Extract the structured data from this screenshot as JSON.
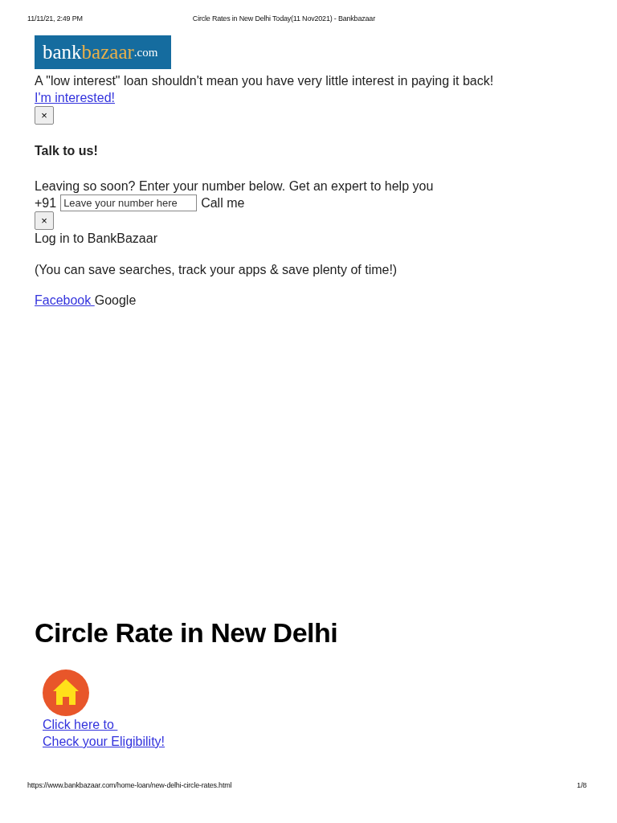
{
  "print_header": {
    "date": "11/11/21, 2:49 PM",
    "title": "Circle Rates in New Delhi Today(11 Nov2021) - Bankbazaar"
  },
  "logo": [
    {
      "text": "bank",
      "color": "#ffffff"
    },
    {
      "text": "bazaar",
      "color": "#e8b04a"
    },
    {
      "text": ".com",
      "color": "#ffffff"
    }
  ],
  "promo": {
    "text": "A \"low interest\" loan shouldn't mean you have very little interest in paying it back!",
    "link": "I'm interested!",
    "close": "×"
  },
  "callback": {
    "title": "Talk to us!",
    "text": "Leaving so soon? Enter your number below. Get an expert to help you",
    "prefix": "+91",
    "placeholder": "Leave your number here",
    "action": "Call me",
    "close": "×"
  },
  "login": {
    "title": "Log in to BankBazaar",
    "text": "(You can save searches, track your apps & save plenty of time!)",
    "links": [
      {
        "kind": "link",
        "text": "Facebook "
      },
      {
        "kind": "plain",
        "text": "Google"
      }
    ]
  },
  "heading": "Circle Rate in New Delhi",
  "eligibility": {
    "lines": [
      "Click here to ",
      "Check your Eligibility!"
    ]
  },
  "print_footer": {
    "url": "https://www.bankbazaar.com/home-loan/new-delhi-circle-rates.html",
    "page": "1/8"
  }
}
